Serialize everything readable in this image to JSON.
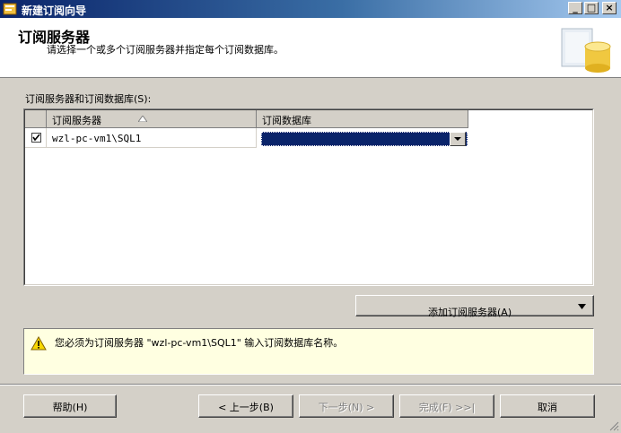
{
  "window": {
    "title": "新建订阅向导",
    "icon": "wizard-icon",
    "controls": [
      "minimize-icon",
      "maximize-icon",
      "close-icon"
    ]
  },
  "header": {
    "title": "订阅服务器",
    "subtitle": "请选择一个或多个订阅服务器并指定每个订阅数据库。"
  },
  "section": {
    "label": "订阅服务器和订阅数据库(S):"
  },
  "grid": {
    "columns": [
      {
        "label": "订阅服务器",
        "sort": "ascending"
      },
      {
        "label": "订阅数据库"
      }
    ],
    "rows": [
      {
        "checked": true,
        "subscriber": "wzl-pc-vm1\\SQL1",
        "database": ""
      }
    ]
  },
  "add_button": {
    "label": "添加订阅服务器(A)"
  },
  "message": {
    "icon": "warning-icon",
    "text": "您必须为订阅服务器 \"wzl-pc-vm1\\SQL1\" 输入订阅数据库名称。"
  },
  "buttons": {
    "help": "帮助(H)",
    "back": "< 上一步(B)",
    "next": "下一步(N) >",
    "finish": "完成(F) >>|",
    "cancel": "取消"
  },
  "colors": {
    "title_bar": "#0a246a",
    "selection": "#0a246a",
    "message_bg": "#ffffe1",
    "dialog_bg": "#d4d0c8"
  }
}
